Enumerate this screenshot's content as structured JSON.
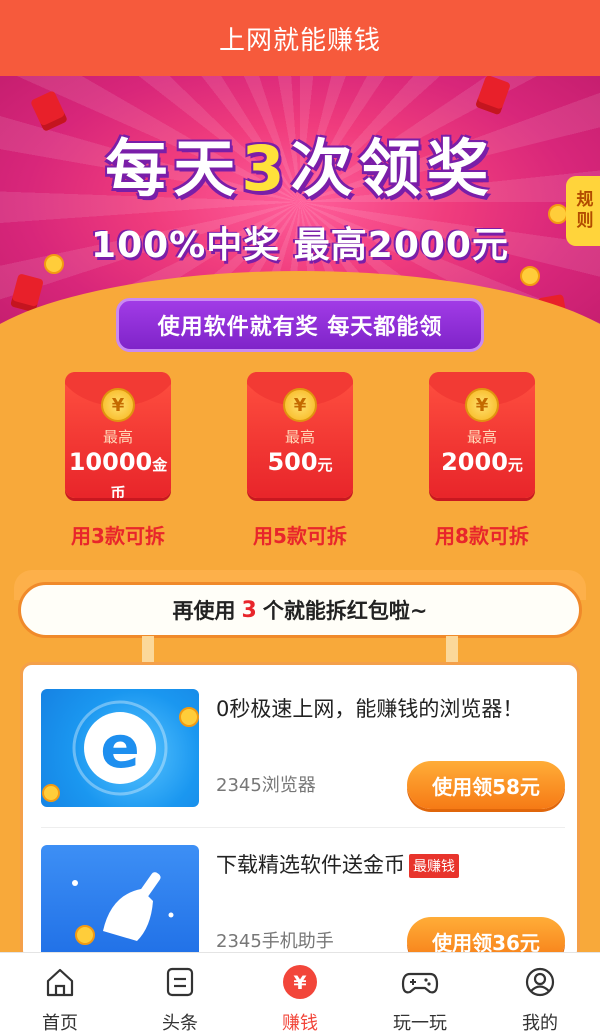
{
  "header": {
    "title": "上网就能赚钱"
  },
  "banner": {
    "title_pre": "每天",
    "title_num": "3",
    "title_post": "次领奖",
    "subtitle": "100%中奖 最高2000元",
    "tagline": "使用软件就有奖 每天都能领",
    "rules_label": "规则"
  },
  "envelopes": [
    {
      "top": "最高",
      "amount": "10000",
      "unit": "金币",
      "label": "用3款可拆"
    },
    {
      "top": "最高",
      "amount": "500",
      "unit": "元",
      "label": "用5款可拆"
    },
    {
      "top": "最高",
      "amount": "2000",
      "unit": "元",
      "label": "用8款可拆"
    }
  ],
  "coin_symbol": "¥",
  "progress_banner": {
    "pre": "再使用",
    "count": "3",
    "post": "个就能拆红包啦~"
  },
  "apps": [
    {
      "title": "0秒极速上网，能赚钱的浏览器！",
      "tag": "",
      "name": "2345浏览器",
      "button": "使用领58元"
    },
    {
      "title": "下载精选软件送金币",
      "tag": "最赚钱",
      "name": "2345手机助手",
      "button": "使用领36元"
    }
  ],
  "tabbar": {
    "items": [
      {
        "label": "首页",
        "icon": "home-icon",
        "active": false
      },
      {
        "label": "头条",
        "icon": "news-icon",
        "active": false
      },
      {
        "label": "赚钱",
        "icon": "yuan-icon",
        "active": true
      },
      {
        "label": "玩一玩",
        "icon": "gamepad-icon",
        "active": false
      },
      {
        "label": "我的",
        "icon": "user-icon",
        "active": false
      }
    ]
  },
  "colors": {
    "header": "#f65a3c",
    "accent_red": "#e8262b",
    "button_orange": "#f67a15",
    "page_bg": "#f8a93a"
  }
}
